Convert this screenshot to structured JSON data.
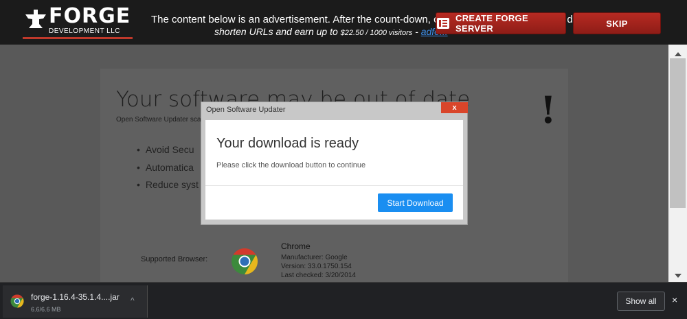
{
  "ad": {
    "logo_big": "FORGE",
    "logo_small": "DEVELOPMENT LLC",
    "line1": "The content below is an advertisement. After the count-down, click Skip to continue to your destination.",
    "line2_prefix": "shorten URLs and earn up to ",
    "line2_amount": "$22.50 / 1000 visitors",
    "line2_sep": " - ",
    "line2_link": "adfo...",
    "create_button": "CREATE FORGE SERVER",
    "skip_button": "SKIP"
  },
  "page": {
    "heading": "Your software may be out of date",
    "sub": "Open Software Updater scan",
    "exclaim": "!",
    "features": [
      "Avoid Secu",
      "Automatica",
      "Reduce syst"
    ],
    "supported_label": "Supported Browser:",
    "browser_name": "Chrome",
    "browser_manufacturer": "Manufacturer: Google",
    "browser_version": "Version: 33.0.1750.154",
    "browser_checked": "Last checked: 3/20/2014"
  },
  "modal": {
    "title": "Open Software Updater",
    "close": "x",
    "heading": "Your download is ready",
    "text": "Please click the download button to continue",
    "button": "Start Download"
  },
  "downloads": {
    "file_name": "forge-1.16.4-35.1.4....jar",
    "file_size": "6.6/6.6 MB",
    "chevron": "^",
    "show_all": "Show all",
    "close": "×"
  }
}
